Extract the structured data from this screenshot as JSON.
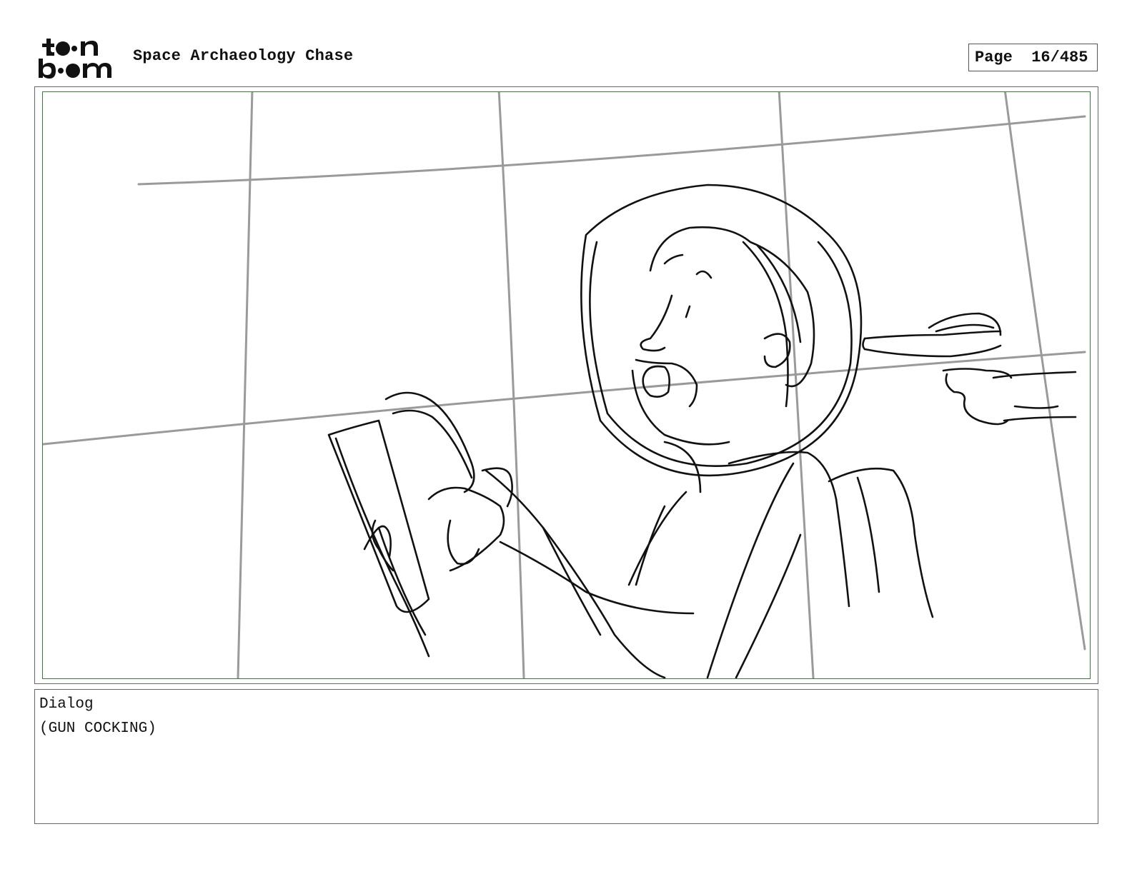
{
  "header": {
    "logo": {
      "line1": "toon",
      "line2": "boom",
      "icon": "toon-boom-logo"
    },
    "project_title": "Space Archaeology Chase",
    "page_label": "Page",
    "page_number": "16/485"
  },
  "panel": {
    "sketch": "storyboard-sketch",
    "frame_color": "#3a7a3a"
  },
  "dialog": {
    "label": "Dialog",
    "text": "(GUN COCKING)"
  }
}
